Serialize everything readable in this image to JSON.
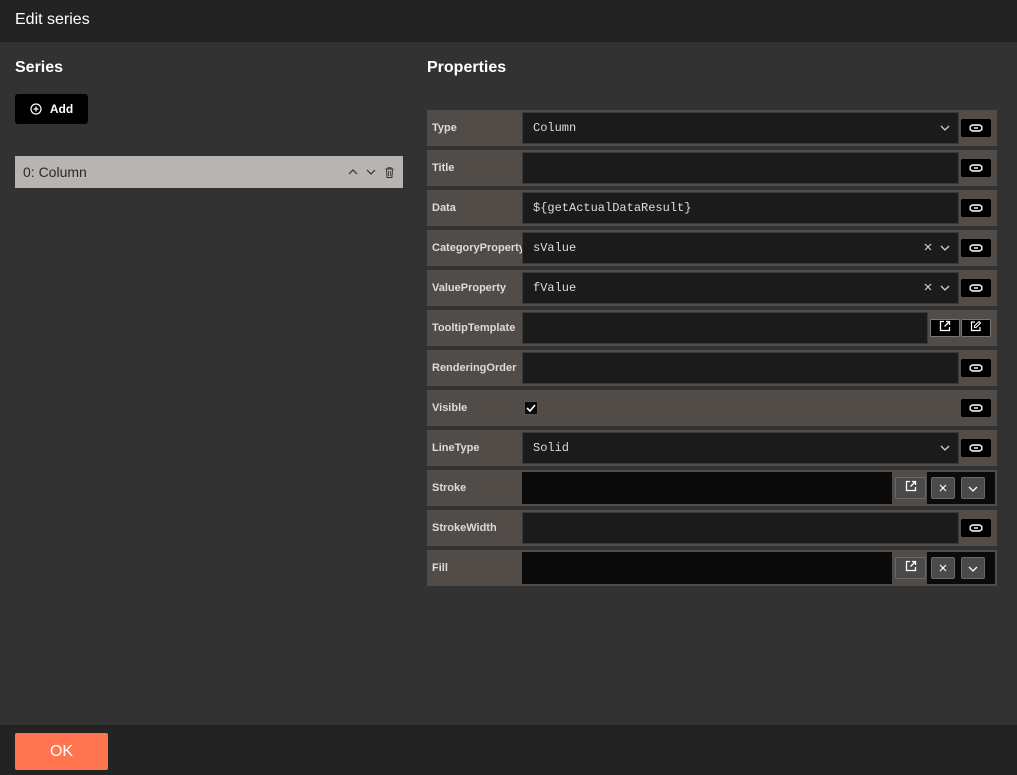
{
  "dialog": {
    "title": "Edit series"
  },
  "series_panel": {
    "heading": "Series",
    "add_label": "Add",
    "items": [
      {
        "label": "0: Column"
      }
    ]
  },
  "properties_panel": {
    "heading": "Properties",
    "rows": {
      "type": {
        "label": "Type",
        "value": "Column"
      },
      "title": {
        "label": "Title",
        "value": ""
      },
      "data": {
        "label": "Data",
        "value": "${getActualDataResult}"
      },
      "category_property": {
        "label": "CategoryProperty",
        "value": "sValue"
      },
      "value_property": {
        "label": "ValueProperty",
        "value": "fValue"
      },
      "tooltip_template": {
        "label": "TooltipTemplate",
        "value": ""
      },
      "rendering_order": {
        "label": "RenderingOrder",
        "value": ""
      },
      "visible": {
        "label": "Visible",
        "checked": true
      },
      "line_type": {
        "label": "LineType",
        "value": "Solid"
      },
      "stroke": {
        "label": "Stroke",
        "color": "#0a0a0a"
      },
      "stroke_width": {
        "label": "StrokeWidth",
        "value": ""
      },
      "fill": {
        "label": "Fill",
        "color": "#0a0a0a"
      }
    }
  },
  "footer": {
    "ok_label": "OK"
  },
  "colors": {
    "accent": "#ff7550",
    "row_bg": "#524c49",
    "selected_series_bg": "#b7b4b1"
  }
}
